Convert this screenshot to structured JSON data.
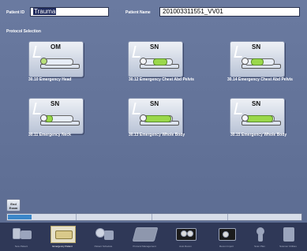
{
  "header": {
    "patient_id_label": "Patient ID",
    "patient_id_value": "Trauma",
    "patient_name_label": "Patient Name",
    "patient_name_value": "201003311551_VV01"
  },
  "protocol_section": {
    "title": "Protocol Selection",
    "protocols": [
      {
        "code": "OM",
        "label": "30.10 Emergency Head",
        "highlight": "head"
      },
      {
        "code": "SN",
        "label": "30.12 Emergency Chest Abd Pelvis",
        "highlight": "chest-abd"
      },
      {
        "code": "SN",
        "label": "30.14 Emergency Chest Abd Pelvis",
        "highlight": "chest"
      },
      {
        "code": "SN",
        "label": "30.11 Emergency Neck",
        "highlight": "neck"
      },
      {
        "code": "SN",
        "label": "30.13 Emergency Whole Body",
        "highlight": "whole"
      },
      {
        "code": "SN",
        "label": "30.15 Emergency Whole Body",
        "highlight": "whole"
      }
    ]
  },
  "end_exam_label": "End Exam",
  "progress": {
    "value_percent": 8
  },
  "taskbar": {
    "items": [
      {
        "label": "New Patient",
        "icon": "patient-icon",
        "active": false
      },
      {
        "label": "Emergency Patient",
        "icon": "emergency-patient-icon",
        "active": true
      },
      {
        "label": "Patient Schedule",
        "icon": "schedule-icon",
        "active": false
      },
      {
        "label": "Protocol Management",
        "icon": "protocol-management-icon",
        "active": false
      },
      {
        "label": "Auto Recon",
        "icon": "auto-recon-icon",
        "active": false
      },
      {
        "label": "Recon Import",
        "icon": "recon-import-icon",
        "active": false
      },
      {
        "label": "Scan Plan",
        "icon": "scan-plan-icon",
        "active": false
      },
      {
        "label": "Scanner Utilities",
        "icon": "scanner-utilities-icon",
        "active": false
      }
    ]
  }
}
